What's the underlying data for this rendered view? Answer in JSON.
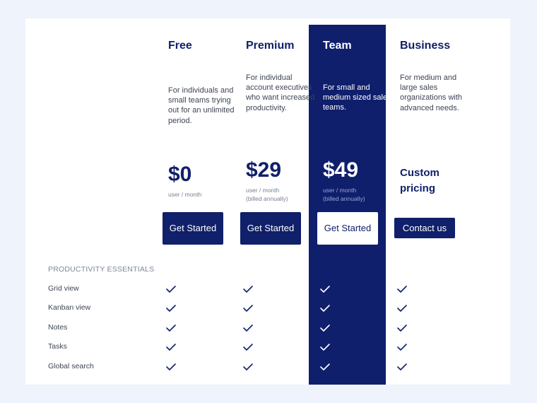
{
  "plans": [
    {
      "name": "Free",
      "description": "For individuals and small teams trying out for an unlimited period.",
      "price": "$0",
      "price_note_line1": "user / month",
      "price_note_line2": "",
      "cta": "Get Started"
    },
    {
      "name": "Premium",
      "description": "For individual account executives who want increased productivity.",
      "price": "$29",
      "price_note_line1": "user / month",
      "price_note_line2": "(billed annually)",
      "cta": "Get Started"
    },
    {
      "name": "Team",
      "description": "For small and medium sized sales teams.",
      "price": "$49",
      "price_note_line1": "user / month",
      "price_note_line2": "(billed annually)",
      "cta": "Get Started",
      "highlighted": true
    },
    {
      "name": "Business",
      "description": "For medium and large sales organizations with advanced needs.",
      "price": "Custom pricing",
      "cta": "Contact us"
    }
  ],
  "features": {
    "section_title": "PRODUCTIVITY ESSENTIALS",
    "rows": [
      {
        "label": "Grid view",
        "included": [
          true,
          true,
          true,
          true
        ]
      },
      {
        "label": "Kanban view",
        "included": [
          true,
          true,
          true,
          true
        ]
      },
      {
        "label": "Notes",
        "included": [
          true,
          true,
          true,
          true
        ]
      },
      {
        "label": "Tasks",
        "included": [
          true,
          true,
          true,
          true
        ]
      },
      {
        "label": "Global search",
        "included": [
          true,
          true,
          true,
          true
        ]
      }
    ]
  },
  "icons": {
    "check": "checkmark-icon"
  },
  "colors": {
    "brand": "#10206a",
    "highlight_column": "#0f1f6b",
    "page_background": "#eef3fc",
    "card_background": "#ffffff"
  }
}
